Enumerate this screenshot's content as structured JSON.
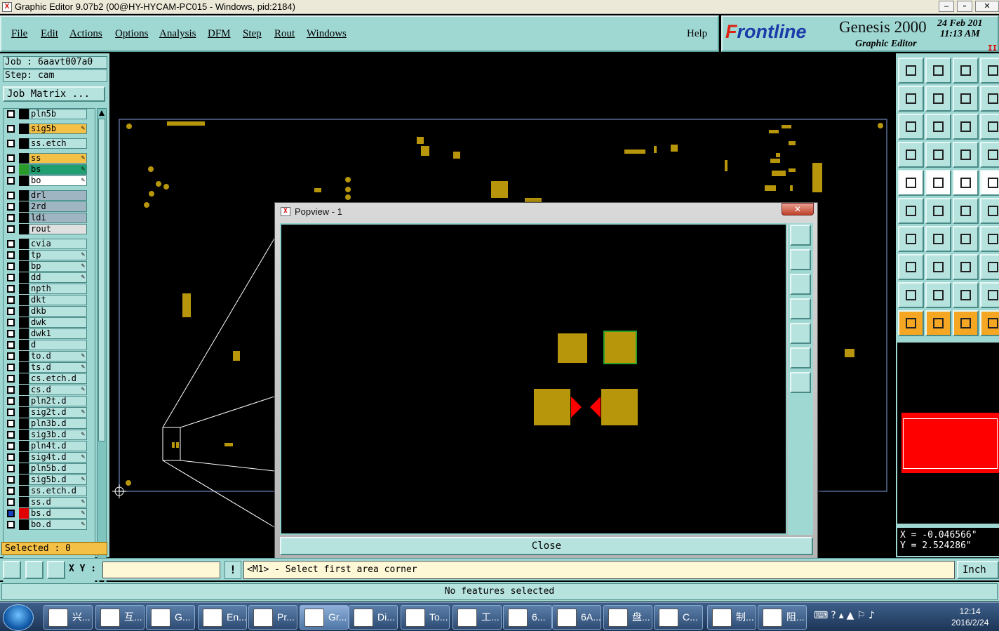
{
  "window": {
    "title": "Graphic Editor 9.07b2 (00@HY-HYCAM-PC015 - Windows, pid:2184)",
    "icon": "app-x-icon"
  },
  "menu": {
    "items": [
      "File",
      "Edit",
      "Actions",
      "Options",
      "Analysis",
      "DFM",
      "Step",
      "Rout",
      "Windows"
    ],
    "help": "Help"
  },
  "brand": {
    "logo_f": "F",
    "logo_rest": "rontline",
    "product": "Genesis 2000",
    "subtitle": "Graphic Editor",
    "date": "24 Feb 201",
    "time": "11:13 AM",
    "pause": "II"
  },
  "job": {
    "job_label": "Job : 6aavt007a0",
    "step_label": "Step: cam",
    "matrix_button": "Job Matrix ..."
  },
  "layers": [
    {
      "name": "pln5b",
      "color": "#b7e3df",
      "editable": false,
      "swatch": "#000000"
    },
    {
      "name": "sig5b",
      "color": "#f5c046",
      "editable": true,
      "swatch": "#000000"
    },
    {
      "name": "ss.etch",
      "color": "#b7e3df",
      "editable": false,
      "swatch": "#000000"
    },
    {
      "name": "ss",
      "color": "#f5c046",
      "editable": true,
      "swatch": "#000000"
    },
    {
      "name": "bs",
      "color": "#20a070",
      "editable": true,
      "swatch": "#2a9a2a"
    },
    {
      "name": "bo",
      "color": "#ffffff",
      "editable": true,
      "swatch": "#000000"
    },
    {
      "name": "drl",
      "color": "#9fb6c2",
      "editable": false,
      "swatch": "#000000"
    },
    {
      "name": "2rd",
      "color": "#9fb6c2",
      "editable": false,
      "swatch": "#000000"
    },
    {
      "name": "ldi",
      "color": "#9fb6c2",
      "editable": false,
      "swatch": "#000000"
    },
    {
      "name": "rout",
      "color": "#e0e0e0",
      "editable": false,
      "swatch": "#000000"
    },
    {
      "name": "cvia",
      "color": "#b7e3df",
      "editable": false,
      "swatch": "#000000"
    },
    {
      "name": "tp",
      "color": "#b7e3df",
      "editable": true,
      "swatch": "#000000"
    },
    {
      "name": "bp",
      "color": "#b7e3df",
      "editable": true,
      "swatch": "#000000"
    },
    {
      "name": "dd",
      "color": "#b7e3df",
      "editable": true,
      "swatch": "#000000"
    },
    {
      "name": "npth",
      "color": "#b7e3df",
      "editable": false,
      "swatch": "#000000"
    },
    {
      "name": "dkt",
      "color": "#b7e3df",
      "editable": false,
      "swatch": "#000000"
    },
    {
      "name": "dkb",
      "color": "#b7e3df",
      "editable": false,
      "swatch": "#000000"
    },
    {
      "name": "dwk",
      "color": "#b7e3df",
      "editable": false,
      "swatch": "#000000"
    },
    {
      "name": "dwk1",
      "color": "#b7e3df",
      "editable": false,
      "swatch": "#000000"
    },
    {
      "name": "d",
      "color": "#b7e3df",
      "editable": false,
      "swatch": "#000000"
    },
    {
      "name": "to.d",
      "color": "#b7e3df",
      "editable": true,
      "swatch": "#000000"
    },
    {
      "name": "ts.d",
      "color": "#b7e3df",
      "editable": true,
      "swatch": "#000000"
    },
    {
      "name": "cs.etch.d",
      "color": "#b7e3df",
      "editable": false,
      "swatch": "#000000"
    },
    {
      "name": "cs.d",
      "color": "#b7e3df",
      "editable": true,
      "swatch": "#000000"
    },
    {
      "name": "pln2t.d",
      "color": "#b7e3df",
      "editable": false,
      "swatch": "#000000"
    },
    {
      "name": "sig2t.d",
      "color": "#b7e3df",
      "editable": true,
      "swatch": "#000000"
    },
    {
      "name": "pln3b.d",
      "color": "#b7e3df",
      "editable": false,
      "swatch": "#000000"
    },
    {
      "name": "sig3b.d",
      "color": "#b7e3df",
      "editable": true,
      "swatch": "#000000"
    },
    {
      "name": "pln4t.d",
      "color": "#b7e3df",
      "editable": false,
      "swatch": "#000000"
    },
    {
      "name": "sig4t.d",
      "color": "#b7e3df",
      "editable": true,
      "swatch": "#000000"
    },
    {
      "name": "pln5b.d",
      "color": "#b7e3df",
      "editable": false,
      "swatch": "#000000"
    },
    {
      "name": "sig5b.d",
      "color": "#b7e3df",
      "editable": true,
      "swatch": "#000000"
    },
    {
      "name": "ss.etch.d",
      "color": "#b7e3df",
      "editable": false,
      "swatch": "#000000"
    },
    {
      "name": "ss.d",
      "color": "#b7e3df",
      "editable": true,
      "swatch": "#000000"
    },
    {
      "name": "bs.d",
      "color": "#b7e3df",
      "editable": true,
      "swatch": "#e00000",
      "checked": true
    },
    {
      "name": "bo.d",
      "color": "#b7e3df",
      "editable": true,
      "swatch": "#000000"
    }
  ],
  "selected": "Selected : 0",
  "popview": {
    "title": "Popview - 1",
    "close_label": "Close"
  },
  "coords": {
    "x": "X = -0.046566\"",
    "y": "Y = 2.524286\""
  },
  "bottom": {
    "xy_label": "X Y :",
    "xy_value": "",
    "excl": "!",
    "prompt": "<M1> - Select first area corner",
    "units": "Inch"
  },
  "status": "No features selected",
  "taskbar": {
    "items": [
      "兴...",
      "互...",
      "G...",
      "En...",
      "Pr...",
      "Gr...",
      "Di...",
      "To...",
      "工...",
      "6...",
      "6A...",
      "盘...",
      "C...",
      "制...",
      "阻..."
    ],
    "time": "12:14",
    "date": "2016/2/24"
  },
  "colors": {
    "accent": "#9fd7d3",
    "pad": "#b8960c",
    "highlight": "#ff0000"
  }
}
